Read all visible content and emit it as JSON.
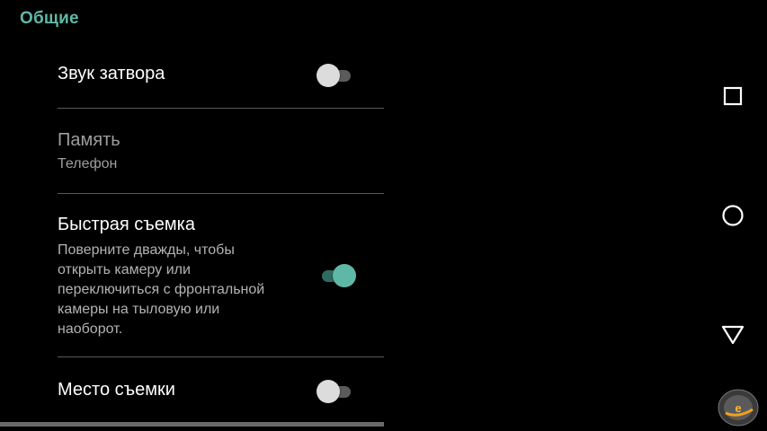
{
  "section": {
    "title": "Общие"
  },
  "settings": {
    "shutter_sound": {
      "title": "Звук затвора",
      "enabled": false
    },
    "storage": {
      "title": "Память",
      "value": "Телефон"
    },
    "quick_capture": {
      "title": "Быстрая съемка",
      "summary_lines": [
        "Поверните дважды, чтобы",
        "открыть камеру или",
        "переключиться с фронтальной",
        "камеры на тыловую или",
        "наоборот."
      ],
      "enabled": true
    },
    "location": {
      "title": "Место съемки",
      "enabled": false
    }
  },
  "navbar": {
    "icons": [
      "recents-icon",
      "home-icon",
      "back-icon"
    ]
  },
  "colors": {
    "accent": "#5fb8a7",
    "background": "#000000"
  }
}
